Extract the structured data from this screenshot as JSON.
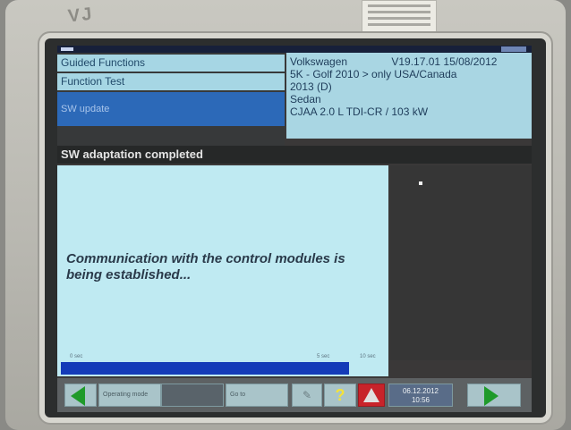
{
  "device": {
    "logo_text": "VJ"
  },
  "nav": {
    "items": [
      {
        "label": "Guided Functions"
      },
      {
        "label": "Function Test"
      },
      {
        "label": "SW update"
      }
    ]
  },
  "vehicle": {
    "make": "Volkswagen",
    "version": "V19.17.01 15/08/2012",
    "model": "5K - Golf  2010 > only USA/Canada",
    "year": "2013 (D)",
    "body": "Sedan",
    "engine": "CJAA 2.0 L TDI-CR / 103 kW"
  },
  "title": "SW adaptation completed",
  "message": "Communication with the control modules is being established...",
  "progress": {
    "ticks": [
      "0 sec",
      "5 sec",
      "10 sec"
    ],
    "fill_fraction": 0.89
  },
  "footer": {
    "operating_mode": "Operating mode",
    "goto": "Go to",
    "help_glyph": "?",
    "date": "06.12.2012",
    "time": "10:56"
  },
  "colors": {
    "nav_bg": "#a6d6e4",
    "nav_selected": "#2c69b8",
    "content_bg": "#bfeaf2",
    "progress_bar": "#143bb8",
    "arrow_green": "#1f9a2a",
    "warning_red": "#c8232a"
  }
}
